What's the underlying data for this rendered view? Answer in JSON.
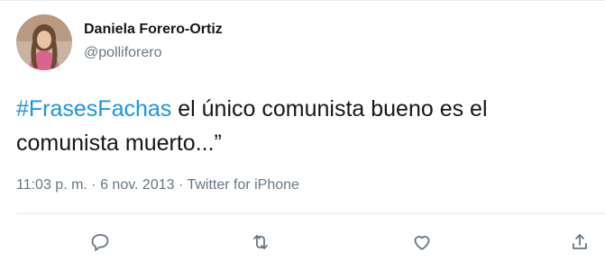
{
  "tweet": {
    "author_name": "Daniela Forero-Ortiz",
    "author_handle": "@polliforero",
    "hashtag": "#FrasesFachas",
    "body": " el único comunista bueno es el comunista muerto...”",
    "meta": "11:03 p. m. · 6 nov. 2013 · Twitter for iPhone"
  },
  "icons": {
    "reply": "reply-icon",
    "retweet": "retweet-icon",
    "like": "heart-icon",
    "share": "share-icon"
  },
  "colors": {
    "hashtag": "#1b95e0",
    "secondary_text": "#657786",
    "primary_text": "#14171a",
    "divider": "#e1e8ed"
  }
}
